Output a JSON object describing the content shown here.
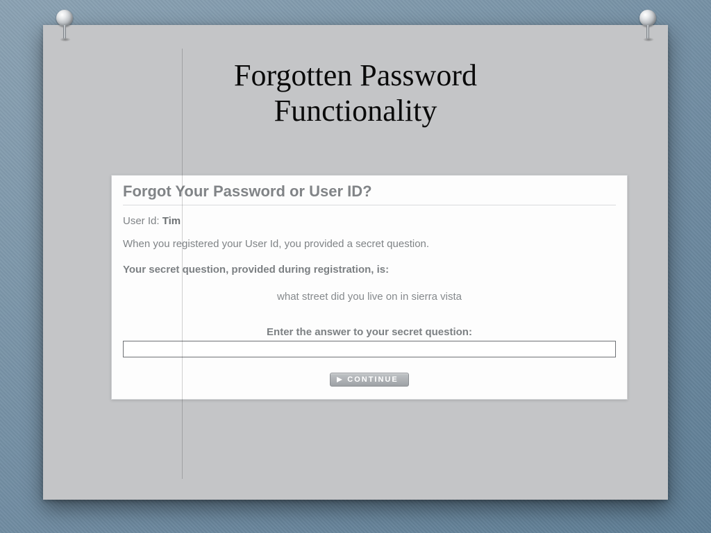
{
  "slide": {
    "title_line1": "Forgotten Password",
    "title_line2": "Functionality"
  },
  "panel": {
    "heading": "Forgot Your Password or User ID?",
    "user_id_label": "User Id:",
    "user_id_value": "Tim",
    "description": "When you registered your User Id, you provided a secret question.",
    "secret_question_heading": "Your secret question, provided during registration, is:",
    "secret_question_text": "what street did you live on in sierra vista",
    "answer_label": "Enter the answer to your secret question:",
    "answer_value": "",
    "continue_label": "CONTINUE"
  }
}
